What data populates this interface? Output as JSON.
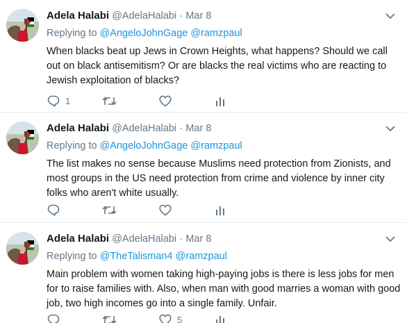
{
  "tweets": [
    {
      "name": "Adela Halabi",
      "handle": "@AdelaHalabi",
      "dot": "·",
      "date": "Mar 8",
      "reply_prefix": "Replying to",
      "mentions": [
        "@AngeloJohnGage",
        "@ramzpaul"
      ],
      "text": "When blacks beat up Jews in Crown Heights, what happens? Should we call out on black antisemitism? Or are blacks the real victims who are reacting to Jewish exploitation of blacks?",
      "reply_count": "1",
      "retweet_count": "",
      "like_count": ""
    },
    {
      "name": "Adela Halabi",
      "handle": "@AdelaHalabi",
      "dot": "·",
      "date": "Mar 8",
      "reply_prefix": "Replying to",
      "mentions": [
        "@AngeloJohnGage",
        "@ramzpaul"
      ],
      "text": "The list makes no sense because Muslims need protection from Zionists, and most groups in the US need protection from crime and violence by inner city folks who aren't white usually.",
      "reply_count": "",
      "retweet_count": "",
      "like_count": ""
    },
    {
      "name": "Adela Halabi",
      "handle": "@AdelaHalabi",
      "dot": "·",
      "date": "Mar 8",
      "reply_prefix": "Replying to",
      "mentions": [
        "@TheTalisman4",
        "@ramzpaul"
      ],
      "text": "Main problem with women taking high-paying jobs is there is less jobs for men for to raise families with. Also, when man with good marries a woman with good job, two high incomes go into a single family.   Unfair.",
      "reply_count": "",
      "retweet_count": "",
      "like_count": "5"
    }
  ],
  "icons": {
    "reply": "reply-icon",
    "retweet": "retweet-icon",
    "like": "heart-icon",
    "stats": "analytics-icon",
    "more": "chevron-down-icon"
  },
  "colors": {
    "secondary_text": "#657786",
    "link": "#1b95e0",
    "divider": "#e6ecf0",
    "primary_text": "#14171a"
  }
}
